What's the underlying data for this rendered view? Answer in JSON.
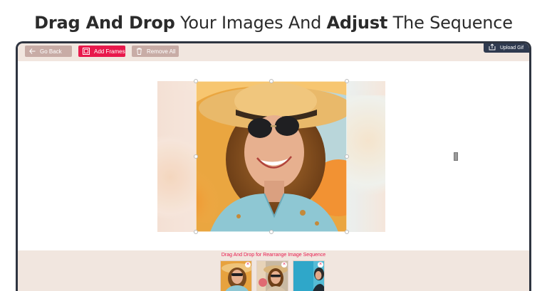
{
  "headline": {
    "part1": "Drag And Drop",
    "part2": " Your Images And ",
    "part3": "Adjust",
    "part4": " The Sequence"
  },
  "toolbar": {
    "go_back": "Go Back",
    "add_frames": "Add Frames",
    "remove_all": "Remove All",
    "upload_gif": "Upload Gif"
  },
  "sequence": {
    "instruction": "Drag And Drop for Rearrange Image Sequence",
    "remove_glyph": "×"
  },
  "colors": {
    "accent": "#e8194c",
    "toolbar_bg": "#f1e6df",
    "secondary_button": "#c8aca6",
    "upload_button": "#2f3a4f",
    "device_frame": "#2e3440"
  },
  "icons": {
    "back": "arrow-left-icon",
    "add": "frame-icon",
    "remove": "trash-icon",
    "upload": "upload-icon"
  }
}
